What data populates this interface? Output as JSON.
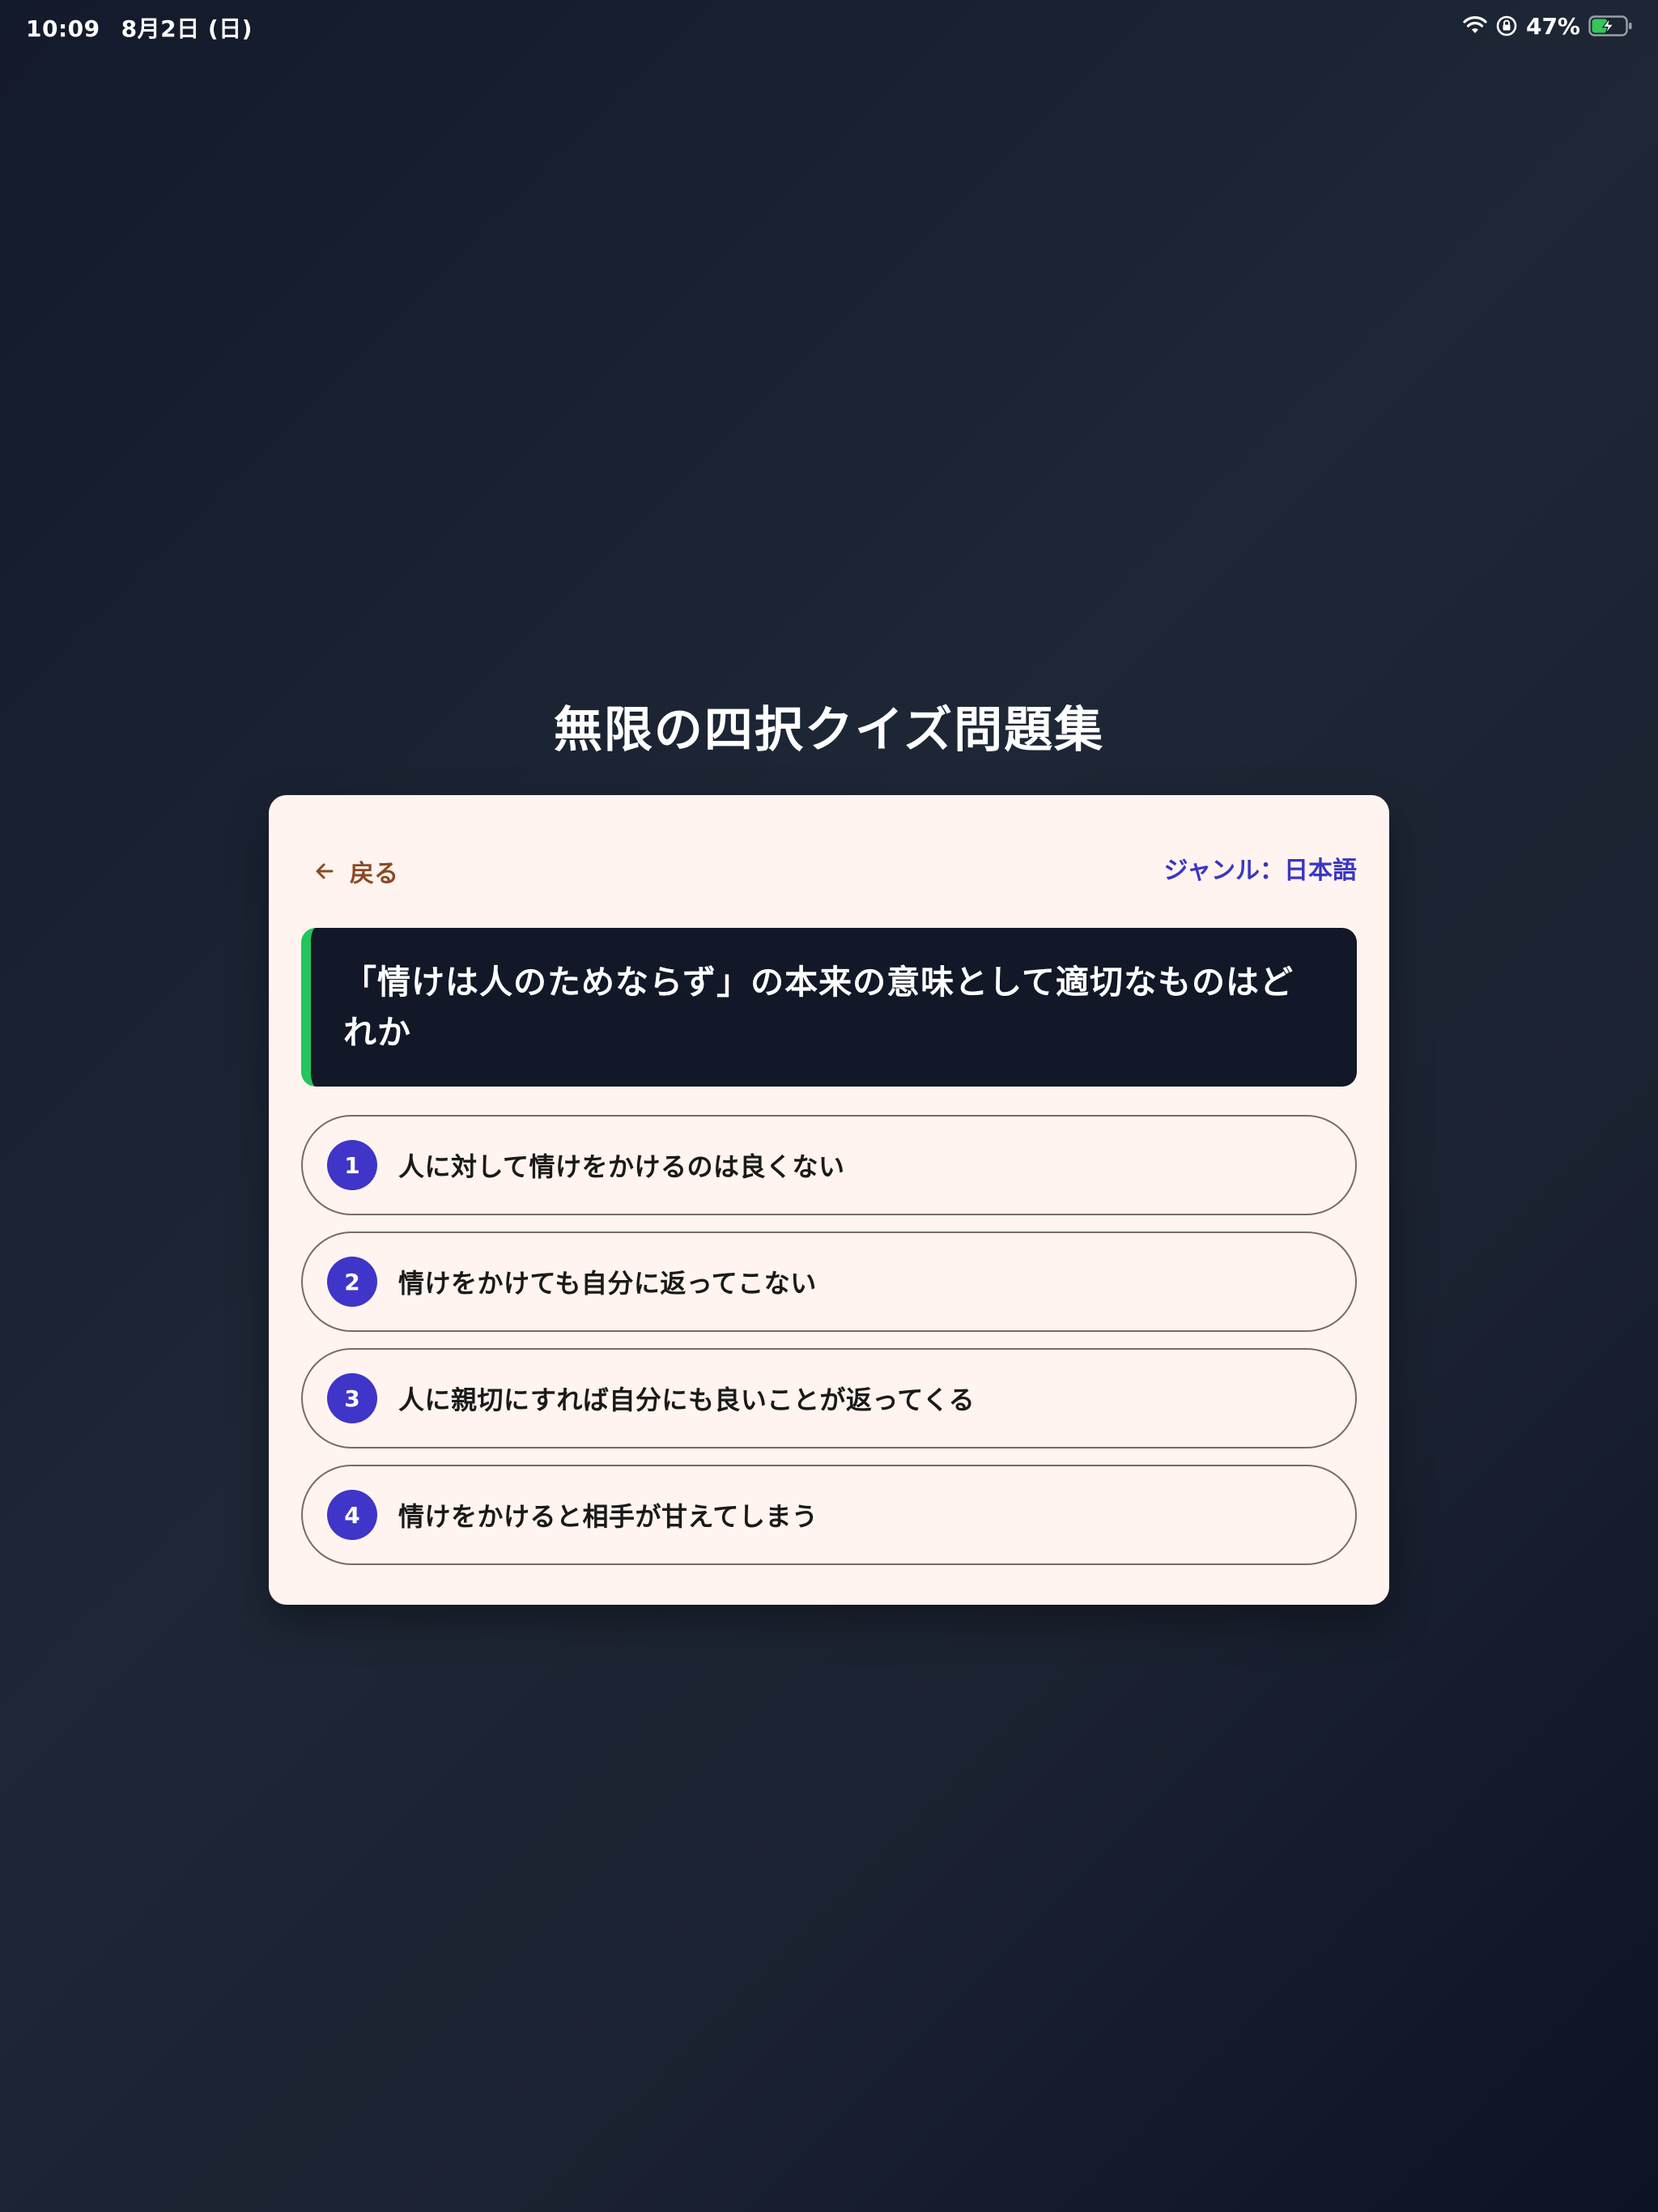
{
  "status_bar": {
    "time": "10:09",
    "date": "8月2日 (日)",
    "battery_percent": "47%",
    "battery_level": 0.47,
    "icons": [
      "wifi-icon",
      "lock-rotation-icon",
      "battery-charging-icon"
    ]
  },
  "app": {
    "title": "無限の四択クイズ問題集"
  },
  "card": {
    "back_label": "戻る",
    "genre": "ジャンル：日本語",
    "question": "「情けは人のためならず」の本来の意味として適切なものはどれか",
    "choices": [
      {
        "number": "1",
        "text": "人に対して情けをかけるのは良くない"
      },
      {
        "number": "2",
        "text": "情けをかけても自分に返ってこない"
      },
      {
        "number": "3",
        "text": "人に親切にすれば自分にも良いことが返ってくる"
      },
      {
        "number": "4",
        "text": "情けをかけると相手が甘えてしまう"
      }
    ]
  },
  "colors": {
    "background": "#1b2231",
    "card": "#fff4ef",
    "question_bg": "#121828",
    "accent_bar": "#22c55e",
    "choice_badge": "#3f35c8",
    "genre_text": "#3b36c4",
    "back_text": "#8a4a26"
  }
}
